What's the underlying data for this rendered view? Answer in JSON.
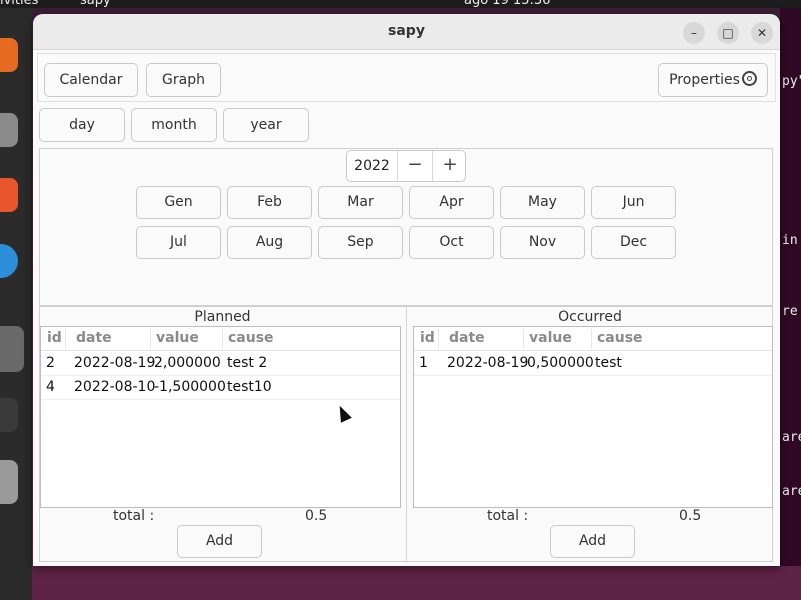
{
  "system": {
    "activities_label": "ivities",
    "app_name": "sapy",
    "clock": "ago 19  15:36"
  },
  "terminal": {
    "lines": [
      "py\"",
      "in",
      "re",
      "are",
      "are"
    ]
  },
  "window": {
    "title": "sapy",
    "minimize_label": "–",
    "maximize_label": "□",
    "close_label": "✕"
  },
  "toolbar": {
    "calendar_label": "Calendar",
    "graph_label": "Graph",
    "properties_label": "Properties"
  },
  "period": {
    "day_label": "day",
    "month_label": "month",
    "year_label": "year"
  },
  "year_selector": {
    "value": "2022",
    "decrement_label": "−",
    "increment_label": "+"
  },
  "months": {
    "row1": [
      "Gen",
      "Feb",
      "Mar",
      "Apr",
      "May",
      "Jun"
    ],
    "row2": [
      "Jul",
      "Aug",
      "Sep",
      "Oct",
      "Nov",
      "Dec"
    ]
  },
  "planned": {
    "title": "Planned",
    "columns": [
      "id",
      "date",
      "value",
      "cause"
    ],
    "rows": [
      {
        "id": "2",
        "date": "2022-08-19",
        "value": "2,000000",
        "cause": "test 2"
      },
      {
        "id": "4",
        "date": "2022-08-10",
        "value": "-1,500000",
        "cause": "test10"
      }
    ],
    "total_label": "total :",
    "total_value": "0.5",
    "add_label": "Add"
  },
  "occurred": {
    "title": "Occurred",
    "columns": [
      "id",
      "date",
      "value",
      "cause"
    ],
    "rows": [
      {
        "id": "1",
        "date": "2022-08-19",
        "value": "0,500000",
        "cause": "test"
      }
    ],
    "total_label": "total :",
    "total_value": "0.5",
    "add_label": "Add"
  }
}
